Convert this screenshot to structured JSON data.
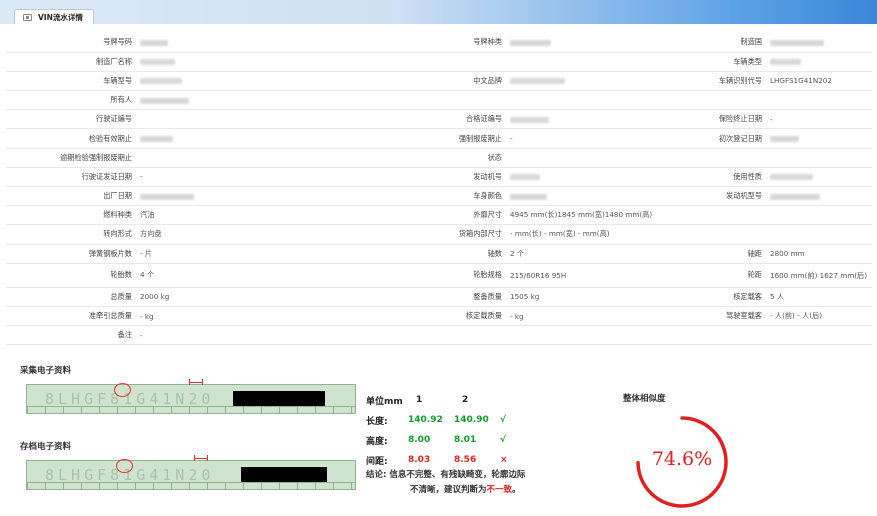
{
  "tab": {
    "title": "VIN流水详情",
    "icon": "panel-icon"
  },
  "rows": [
    [
      {
        "l": "号牌号码",
        "v": "",
        "blur": true
      },
      {
        "l": "号牌种类",
        "v": "",
        "blur": true
      },
      {
        "l": "制造国",
        "v": "",
        "blur": true
      }
    ],
    [
      {
        "l": "制造厂名称",
        "v": "",
        "blur": true
      },
      {
        "l": "",
        "v": ""
      },
      {
        "l": "车辆类型",
        "v": "",
        "blur": true
      }
    ],
    [
      {
        "l": "车辆型号",
        "v": "",
        "blur": true
      },
      {
        "l": "中文品牌",
        "v": "",
        "blur": true
      },
      {
        "l": "车辆识别代号",
        "v": "LHGFS1G41N202"
      }
    ],
    [
      {
        "l": "所有人",
        "v": "",
        "blur": true
      },
      {
        "l": "",
        "v": ""
      },
      {
        "l": "",
        "v": ""
      }
    ],
    [
      {
        "l": "行驶证编号",
        "v": ""
      },
      {
        "l": "合格证编号",
        "v": "",
        "blur": true
      },
      {
        "l": "保险终止日期",
        "v": "-"
      }
    ],
    [
      {
        "l": "检验有效期止",
        "v": "",
        "blur": true
      },
      {
        "l": "强制报废期止",
        "v": "-"
      },
      {
        "l": "初次登记日期",
        "v": "",
        "blur": true
      }
    ],
    [
      {
        "l": "逾期检验强制报废期止",
        "v": ""
      },
      {
        "l": "状态",
        "v": ""
      },
      {
        "l": "",
        "v": ""
      }
    ],
    [
      {
        "l": "行驶证发证日期",
        "v": "-"
      },
      {
        "l": "发动机号",
        "v": "",
        "blur": true
      },
      {
        "l": "使用性质",
        "v": "",
        "blur": true
      }
    ],
    [
      {
        "l": "出厂日期",
        "v": "",
        "blur": true
      },
      {
        "l": "车身颜色",
        "v": "",
        "blur": true
      },
      {
        "l": "发动机型号",
        "v": "",
        "blur": true
      }
    ],
    [
      {
        "l": "燃料种类",
        "v": "汽油"
      },
      {
        "l": "外廓尺寸",
        "v": "4945 mm(长)1845 mm(宽)1480 mm(高)"
      },
      {
        "l": "",
        "v": ""
      }
    ],
    [
      {
        "l": "转向形式",
        "v": "方向盘"
      },
      {
        "l": "货箱内部尺寸",
        "v": "- mm(长) - mm(宽) - mm(高)"
      },
      {
        "l": "",
        "v": ""
      }
    ],
    [
      {
        "l": "弹簧钢板片数",
        "v": "- 片"
      },
      {
        "l": "轴数",
        "v": "2 个"
      },
      {
        "l": "轴距",
        "v": "2800 mm"
      }
    ],
    [
      {
        "l": "轮胎数",
        "v": "4 个"
      },
      {
        "l": "轮胎规格",
        "v": "215/60R16 95H"
      },
      {
        "l": "轮距",
        "v": "1600 mm(前) 1627 mm(后)"
      }
    ],
    [
      {
        "l": "总质量",
        "v": "2000 kg"
      },
      {
        "l": "整备质量",
        "v": "1505 kg"
      },
      {
        "l": "核定载客",
        "v": "5 人"
      }
    ],
    [
      {
        "l": "准牵引总质量",
        "v": "- kg"
      },
      {
        "l": "核定载质量",
        "v": "- kg"
      },
      {
        "l": "驾驶室载客",
        "v": "- 人(前) - 人(后)"
      }
    ],
    [
      {
        "l": "备注",
        "v": "-"
      },
      {
        "l": "",
        "v": ""
      },
      {
        "l": "",
        "v": ""
      }
    ]
  ],
  "collected": {
    "title": "采集电子资料",
    "ghost_text": "8LHGF81G41N20"
  },
  "archived": {
    "title": "存档电子资料",
    "ghost_text": "8LHGF81G41N20"
  },
  "measure": {
    "unit": "单位mm",
    "col1": "1",
    "col2": "2",
    "rows": [
      {
        "label": "长度:",
        "v1": "140.92",
        "v2": "140.90",
        "mark": "√",
        "color": "#119a2a"
      },
      {
        "label": "高度:",
        "v1": "8.00",
        "v2": "8.01",
        "mark": "√",
        "color": "#119a2a"
      },
      {
        "label": "间距:",
        "v1": "8.03",
        "v2": "8.56",
        "mark": "×",
        "color": "#e02020"
      }
    ]
  },
  "conclusion": {
    "lead": "结论:",
    "text1": "信息不完整、有残缺畸变，轮廓边际",
    "text2": "不清晰，建议判断为",
    "verdict": "不一致",
    "end": "。"
  },
  "similarity": {
    "title": "整体相似度",
    "value": "74.6%",
    "fraction": 0.746,
    "color": "#e02020"
  }
}
